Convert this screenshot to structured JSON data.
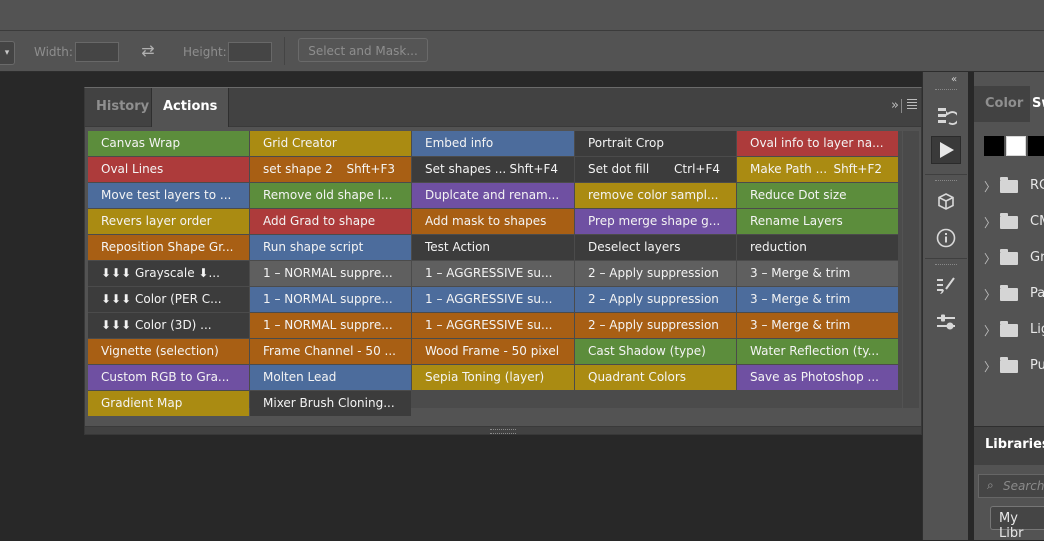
{
  "options_bar": {
    "width_label": "Width:",
    "height_label": "Height:",
    "select_mask_label": "Select and Mask..."
  },
  "actions_panel": {
    "tabs": [
      "History",
      "Actions"
    ],
    "active_tab": "Actions",
    "collapse_glyph": "»",
    "colors": {
      "green": "#5c8d3c",
      "yellow": "#aa8b12",
      "blue": "#4c6c9c",
      "dark": "#3c3c3c",
      "red": "#ad3b3b",
      "orange": "#a85f14",
      "violet": "#6f50a2",
      "gray": "#5f5f5f"
    },
    "buttons": [
      [
        {
          "name": "Canvas Wrap",
          "color": "green",
          "shortcut": ""
        },
        {
          "name": "Oval Lines",
          "color": "red",
          "shortcut": ""
        },
        {
          "name": "Move test layers to ...",
          "color": "blue",
          "shortcut": ""
        },
        {
          "name": "Revers layer order",
          "color": "yellow",
          "shortcut": ""
        },
        {
          "name": "Reposition Shape Gr...",
          "color": "orange",
          "shortcut": ""
        },
        {
          "name": "⬇⬇⬇ Grayscale ⬇...",
          "color": "dark",
          "shortcut": ""
        },
        {
          "name": "⬇⬇⬇ Color (PER C...",
          "color": "dark",
          "shortcut": ""
        },
        {
          "name": "⬇⬇⬇ Color (3D) ...",
          "color": "dark",
          "shortcut": ""
        },
        {
          "name": "Vignette (selection)",
          "color": "orange",
          "shortcut": ""
        },
        {
          "name": "Custom RGB to Gra...",
          "color": "violet",
          "shortcut": ""
        },
        {
          "name": "Gradient Map",
          "color": "yellow",
          "shortcut": ""
        }
      ],
      [
        {
          "name": "Grid Creator",
          "color": "yellow",
          "shortcut": ""
        },
        {
          "name": "set shape 2",
          "color": "orange",
          "shortcut": "Shft+F3"
        },
        {
          "name": "Remove old shape l...",
          "color": "green",
          "shortcut": ""
        },
        {
          "name": "Add Grad to shape",
          "color": "red",
          "shortcut": ""
        },
        {
          "name": "Run shape script",
          "color": "blue",
          "shortcut": ""
        },
        {
          "name": "1 – NORMAL suppre...",
          "color": "gray",
          "shortcut": ""
        },
        {
          "name": "1 – NORMAL suppre...",
          "color": "blue",
          "shortcut": ""
        },
        {
          "name": "1 – NORMAL suppre...",
          "color": "orange",
          "shortcut": ""
        },
        {
          "name": "Frame Channel - 50 ...",
          "color": "orange",
          "shortcut": ""
        },
        {
          "name": "Molten Lead",
          "color": "blue",
          "shortcut": ""
        },
        {
          "name": "Mixer Brush Cloning...",
          "color": "dark",
          "shortcut": ""
        }
      ],
      [
        {
          "name": "Embed info",
          "color": "blue",
          "shortcut": ""
        },
        {
          "name": "Set shapes ...",
          "color": "dark",
          "shortcut": "Shft+F4"
        },
        {
          "name": "Duplcate and renam...",
          "color": "violet",
          "shortcut": ""
        },
        {
          "name": "Add mask to shapes",
          "color": "orange",
          "shortcut": ""
        },
        {
          "name": "Test Action",
          "color": "dark",
          "shortcut": ""
        },
        {
          "name": "1 – AGGRESSIVE su...",
          "color": "gray",
          "shortcut": ""
        },
        {
          "name": "1 – AGGRESSIVE su...",
          "color": "blue",
          "shortcut": ""
        },
        {
          "name": "1 – AGGRESSIVE su...",
          "color": "orange",
          "shortcut": ""
        },
        {
          "name": "Wood Frame - 50 pixel",
          "color": "orange",
          "shortcut": ""
        },
        {
          "name": "Sepia Toning (layer)",
          "color": "yellow",
          "shortcut": ""
        }
      ],
      [
        {
          "name": "Portrait Crop",
          "color": "dark",
          "shortcut": ""
        },
        {
          "name": "Set dot fill",
          "color": "dark",
          "shortcut": "Ctrl+F4"
        },
        {
          "name": "remove color sampl...",
          "color": "yellow",
          "shortcut": ""
        },
        {
          "name": "Prep merge shape g...",
          "color": "violet",
          "shortcut": ""
        },
        {
          "name": "Deselect layers",
          "color": "dark",
          "shortcut": ""
        },
        {
          "name": "2 – Apply suppression",
          "color": "gray",
          "shortcut": ""
        },
        {
          "name": "2 – Apply suppression",
          "color": "blue",
          "shortcut": ""
        },
        {
          "name": "2 – Apply suppression",
          "color": "orange",
          "shortcut": ""
        },
        {
          "name": "Cast Shadow (type)",
          "color": "green",
          "shortcut": ""
        },
        {
          "name": "Quadrant Colors",
          "color": "yellow",
          "shortcut": ""
        }
      ],
      [
        {
          "name": "Oval info to layer na...",
          "color": "red",
          "shortcut": ""
        },
        {
          "name": "Make Path ...",
          "color": "yellow",
          "shortcut": "Shft+F2"
        },
        {
          "name": "Reduce Dot size",
          "color": "green",
          "shortcut": ""
        },
        {
          "name": "Rename Layers",
          "color": "green",
          "shortcut": ""
        },
        {
          "name": "reduction",
          "color": "dark",
          "shortcut": ""
        },
        {
          "name": "3 – Merge & trim",
          "color": "gray",
          "shortcut": ""
        },
        {
          "name": "3 – Merge & trim",
          "color": "blue",
          "shortcut": ""
        },
        {
          "name": "3 – Merge & trim",
          "color": "orange",
          "shortcut": ""
        },
        {
          "name": "Water Reflection (ty...",
          "color": "green",
          "shortcut": ""
        },
        {
          "name": "Save as Photoshop ...",
          "color": "violet",
          "shortcut": ""
        }
      ]
    ]
  },
  "tool_dock": {
    "collapse_glyph": "«",
    "icons": [
      "history-brush-icon",
      "play-action-icon",
      "3d-cube-icon",
      "info-icon",
      "brush-settings-icon",
      "adjust-icon"
    ]
  },
  "right_panel": {
    "tabs": [
      "Color",
      "Sw"
    ],
    "active_tab": "Sw",
    "swatch_colors": [
      "#000000",
      "#ffffff",
      "#000000"
    ],
    "swatch_groups": [
      "RG",
      "CM",
      "Gr",
      "Pa",
      "Lig",
      "Pu"
    ],
    "libraries_title": "Libraries",
    "search_placeholder": "Search",
    "library_select": "My Libr"
  }
}
